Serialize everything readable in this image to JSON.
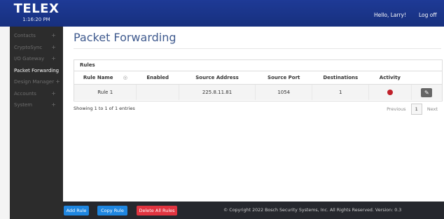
{
  "header": {
    "logo": "TELEX",
    "clock": "1:16:20 PM",
    "greeting": "Hello, Larry!",
    "logoff": "Log off"
  },
  "sidebar": {
    "items": [
      {
        "label": "Contacts",
        "expand": "+"
      },
      {
        "label": "CryptoSync",
        "expand": "+"
      },
      {
        "label": "I/O Gateway",
        "expand": "+"
      },
      {
        "label": "Packet Forwarding",
        "expand": ""
      },
      {
        "label": "Design Manager",
        "expand": "+"
      },
      {
        "label": "Accounts",
        "expand": "+"
      },
      {
        "label": "System",
        "expand": "+"
      }
    ]
  },
  "main": {
    "title": "Packet Forwarding",
    "panel_title": "Rules",
    "columns": [
      "Rule Name",
      "Enabled",
      "Source Address",
      "Source Port",
      "Destinations",
      "Activity"
    ],
    "rows": [
      {
        "rule_name": "Rule 1",
        "enabled": "",
        "source_address": "225.8.11.81",
        "source_port": "1054",
        "destinations": "1"
      }
    ],
    "info": "Showing 1 to 1 of 1 entries",
    "pager": {
      "previous": "Previous",
      "current": "1",
      "next": "Next"
    }
  },
  "footer": {
    "add_rule": "Add Rule",
    "copy_rule": "Copy Rule",
    "delete_all": "Delete All Rules",
    "copyright": "© Copyright 2022 Bosch Security Systems, Inc. All Rights Reserved. Version: 0.3"
  },
  "colors": {
    "topbar": "#1e3a96",
    "sidebar": "#2c2c2c",
    "accent_blue": "#1f86e0",
    "danger_red": "#e03440",
    "activity_dot": "#c0202a"
  },
  "icons": {
    "sort": "sort-icon",
    "activity": "activity-indicator-icon",
    "edit": "edit-icon"
  }
}
